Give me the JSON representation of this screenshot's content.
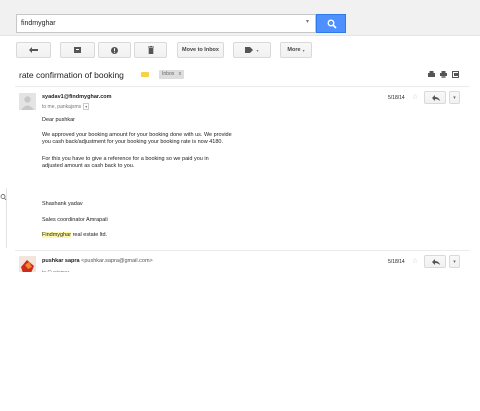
{
  "search": {
    "value": "findmyghar",
    "dropdown_glyph": "▾",
    "button_icon": "search-icon"
  },
  "toolbar": {
    "back_icon": "back-arrow-icon",
    "archive_icon": "archive-icon",
    "spam_icon": "report-spam-icon",
    "delete_icon": "trash-icon",
    "move_to_inbox_label": "Move to Inbox",
    "labels_icon": "label-icon",
    "more_label": "More"
  },
  "thread": {
    "subject": "rate confirmation of booking",
    "label": "Inbox",
    "label_close": "x",
    "header_icons": [
      "print-all-icon",
      "print-icon",
      "new-window-icon"
    ]
  },
  "messages": [
    {
      "sender": "syadav1@findmyghar.com",
      "to_line": "to me, pankajsms",
      "to_dd": "▾",
      "date": "5/18/14",
      "body": {
        "greeting": "Dear pushkar",
        "p1_l1": "We approved your booking amount for your booking done with us. We provide",
        "p1_l2": "you cash back/adjustment for your booking your booking rate is now 4180.",
        "p2_l1": "For this you have to give a reference for a booking so we paid you in",
        "p2_l2": "adjusted amount as cash back to you.",
        "sig_name": "Shashank yadav",
        "sig_title": "Sales coordinator Amrapali",
        "sig_company_hl": "Findmyghar",
        "sig_company_rest": " real estate ltd."
      }
    },
    {
      "sender": "pushkar sapra",
      "sender_email": "<pushkar.sapra@gmail.com>",
      "to_line": "to Customer",
      "date": "5/18/14"
    }
  ],
  "colors": {
    "search_button": "#4d90fe",
    "important_marker": "#f6d24a",
    "highlight": "#fff7a8"
  }
}
